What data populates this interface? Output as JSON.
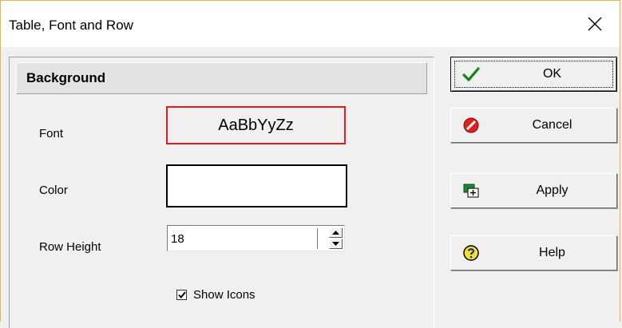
{
  "window": {
    "title": "Table, Font and Row"
  },
  "panel": {
    "header": "Background",
    "font_label": "Font",
    "font_preview": "AaBbYyZz",
    "color_label": "Color",
    "color_value": "#ffffff",
    "row_height_label": "Row Height",
    "row_height_value": "18",
    "show_icons_label": "Show Icons",
    "show_icons_checked": true
  },
  "buttons": {
    "ok": "OK",
    "cancel": "Cancel",
    "apply": "Apply",
    "help": "Help"
  },
  "colors": {
    "font_box_border": "#e21b1b",
    "ok_check": "#2e9e2e",
    "cancel_red": "#e02020",
    "help_yellow": "#f2e030"
  }
}
